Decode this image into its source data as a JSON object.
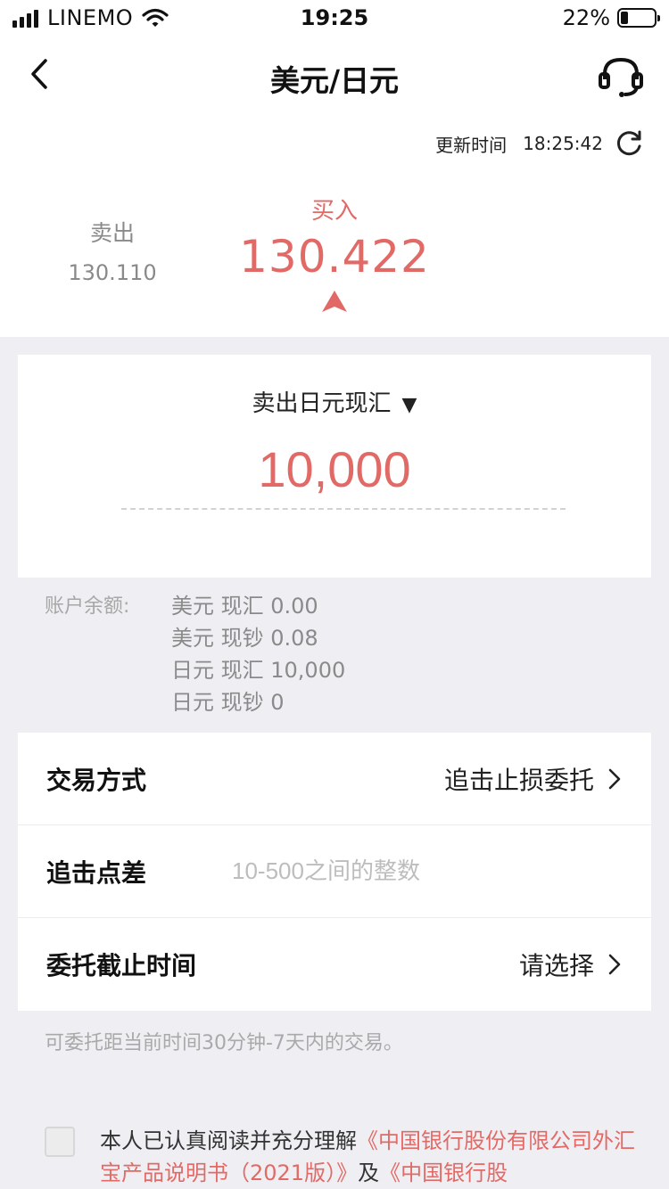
{
  "status_bar": {
    "carrier": "LINEMO",
    "time": "19:25",
    "battery": "22%"
  },
  "nav": {
    "title": "美元/日元"
  },
  "quote": {
    "update_label": "更新时间",
    "update_time": "18:25:42",
    "sell_label": "卖出",
    "sell_price": "130.110",
    "buy_label": "买入",
    "buy_price": "130.422"
  },
  "order": {
    "currency_select": "卖出日元现汇",
    "amount": "10,000"
  },
  "balances": {
    "label": "账户余额:",
    "items": [
      "美元 现汇 0.00",
      "美元 现钞 0.08",
      "日元 现汇 10,000",
      "日元 现钞 0"
    ]
  },
  "settings": {
    "trade_method_label": "交易方式",
    "trade_method_value": "追击止损委托",
    "chase_spread_label": "追击点差",
    "chase_spread_placeholder": "10-500之间的整数",
    "deadline_label": "委托截止时间",
    "deadline_value": "请选择"
  },
  "hint": "可委托距当前时间30分钟-7天内的交易。",
  "agreement": {
    "prefix": "本人已认真阅读并充分理解",
    "doc1": "《中国银行股份有限公司外汇宝产品说明书（2021版）》",
    "joiner": "及",
    "doc2": "《中国银行股"
  },
  "colors": {
    "accent_red": "#e26a66",
    "background": "#efeff3"
  }
}
